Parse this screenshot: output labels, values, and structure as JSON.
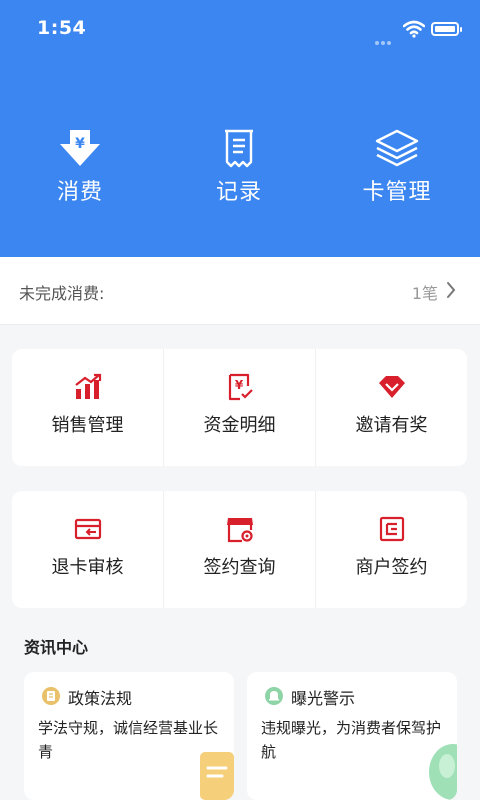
{
  "status_bar": {
    "time": "1:54"
  },
  "quick_actions": [
    {
      "label": "消费",
      "icon": "yen-download-icon"
    },
    {
      "label": "记录",
      "icon": "receipt-icon"
    },
    {
      "label": "卡管理",
      "icon": "layers-icon"
    }
  ],
  "pending": {
    "label": "未完成消费:",
    "count": "1笔"
  },
  "menu_row1": [
    {
      "label": "销售管理",
      "icon": "bar-chart-icon"
    },
    {
      "label": "资金明细",
      "icon": "yen-doc-icon"
    },
    {
      "label": "邀请有奖",
      "icon": "diamond-icon"
    }
  ],
  "menu_row2": [
    {
      "label": "退卡审核",
      "icon": "card-return-icon"
    },
    {
      "label": "签约查询",
      "icon": "store-search-icon"
    },
    {
      "label": "商户签约",
      "icon": "contract-icon"
    }
  ],
  "news": {
    "title": "资讯中心",
    "cards": [
      {
        "title": "政策法规",
        "desc": "学法守规，诚信经营基业长青"
      },
      {
        "title": "曝光警示",
        "desc": "违规曝光，为消费者保驾护航"
      }
    ]
  },
  "colors": {
    "primary": "#3b86f0",
    "icon_red": "#d8202c"
  }
}
